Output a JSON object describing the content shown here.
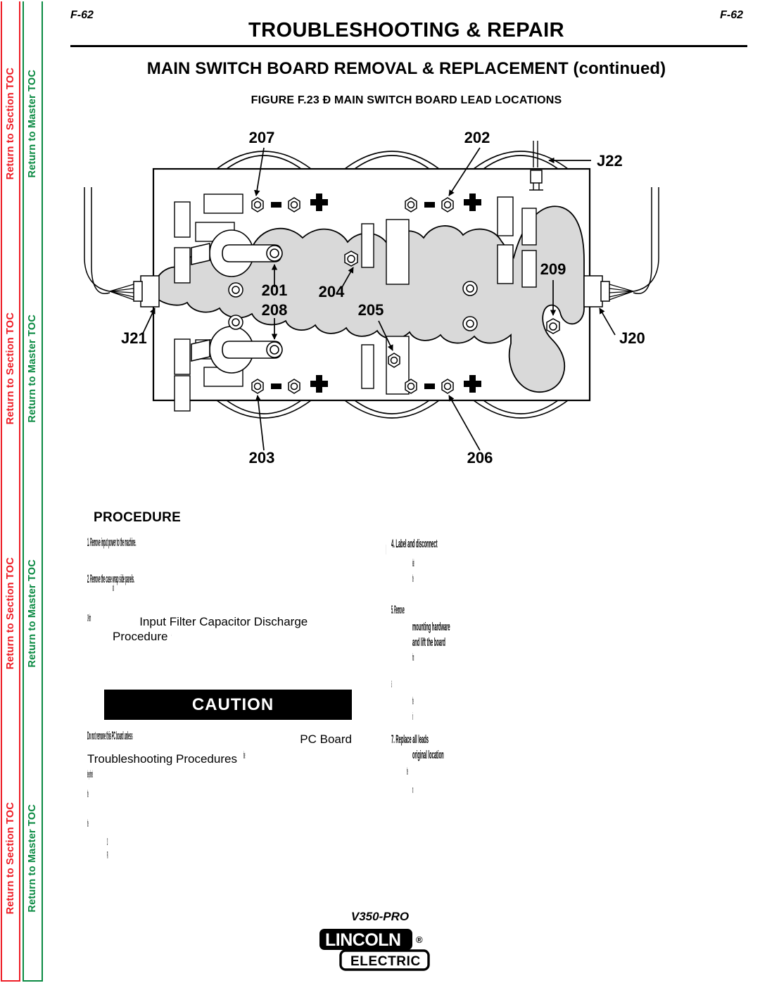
{
  "sidebar": {
    "section_toc_label": "Return to Section TOC",
    "master_toc_label": "Return to Master TOC",
    "repeats": 4,
    "section_color": "#ee1c25",
    "master_color": "#0a8a42"
  },
  "header": {
    "page_number_left": "F-62",
    "page_number_right": "F-62",
    "document_title": "TROUBLESHOOTING & REPAIR",
    "section_title": "MAIN SWITCH BOARD REMOVAL & REPLACEMENT (continued)",
    "figure_caption": "FIGURE F.23 Đ MAIN SWITCH BOARD LEAD LOCATIONS"
  },
  "figure": {
    "callouts": [
      {
        "id": "callout-207",
        "label": "207"
      },
      {
        "id": "callout-202",
        "label": "202"
      },
      {
        "id": "callout-j22",
        "label": "J22"
      },
      {
        "id": "callout-201",
        "label": "201"
      },
      {
        "id": "callout-204",
        "label": "204"
      },
      {
        "id": "callout-209",
        "label": "209"
      },
      {
        "id": "callout-208",
        "label": "208"
      },
      {
        "id": "callout-205",
        "label": "205"
      },
      {
        "id": "callout-j21",
        "label": "J21"
      },
      {
        "id": "callout-j20",
        "label": "J20"
      },
      {
        "id": "callout-203",
        "label": "203"
      },
      {
        "id": "callout-206",
        "label": "206"
      }
    ],
    "board_fill": "#ffffff",
    "heatsink_fill": "#d9d9d9",
    "outline_color": "#000000"
  },
  "procedure": {
    "heading": "PROCEDURE",
    "left_column": {
      "line_1": "1.",
      "line_2": "2.",
      "line_3_marker": "3.",
      "line_3_visible": "Input Filter Capacitor Discharge",
      "line_4_visible": "Procedure",
      "caution_line_a_visible": "PC Board",
      "caution_line_b_visible": "Troubleshooting Procedures"
    },
    "caution": {
      "label": "CAUTION",
      "icon": "warning-triangle-icon"
    }
  },
  "footer": {
    "model": "V350-PRO",
    "brand_primary": "LINCOLN",
    "brand_secondary": "ELECTRIC",
    "brand_mark": "®"
  }
}
